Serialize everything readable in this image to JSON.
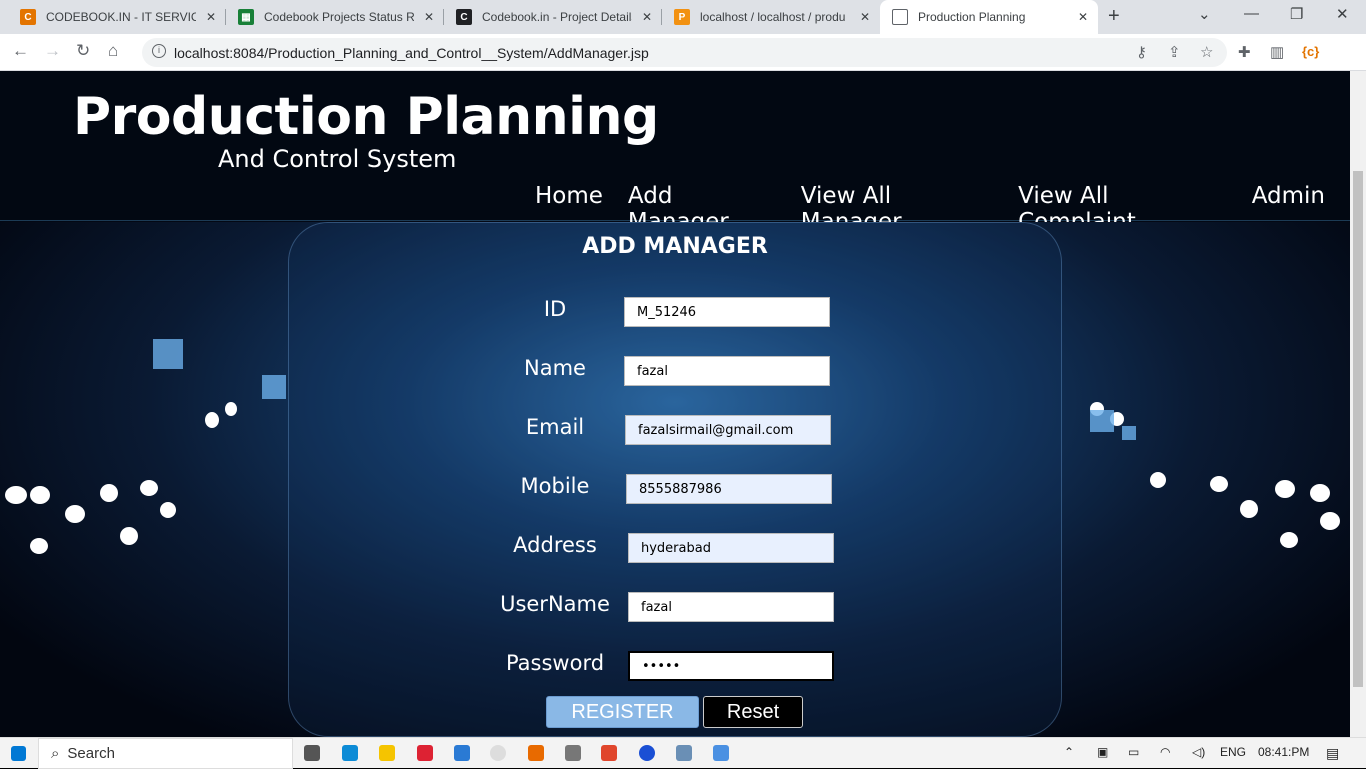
{
  "browser": {
    "tabs": [
      {
        "title": "CODEBOOK.IN - IT SERVICES",
        "icon": "codebook-icon"
      },
      {
        "title": "Codebook Projects Status Re",
        "icon": "sheets-icon"
      },
      {
        "title": "Codebook.in - Project Details",
        "icon": "codebook-dark-icon"
      },
      {
        "title": "localhost / localhost / produ",
        "icon": "phpmyadmin-icon"
      },
      {
        "title": "Production Planning",
        "icon": "page-icon"
      }
    ],
    "url": "localhost:8084/Production_Planning_and_Control__System/AddManager.jsp"
  },
  "header": {
    "title": "Production Planning",
    "subtitle": "And Control System",
    "nav": [
      "Home",
      "Add Manager",
      "View All Manager",
      "View All Complaint",
      "Admin"
    ]
  },
  "form": {
    "title": "ADD MANAGER",
    "fields": [
      {
        "label": "ID",
        "value": "M_51246"
      },
      {
        "label": "Name",
        "value": "fazal"
      },
      {
        "label": "Email",
        "value": "fazalsirmail@gmail.com"
      },
      {
        "label": "Mobile",
        "value": "8555887986"
      },
      {
        "label": "Address",
        "value": "hyderabad"
      },
      {
        "label": "UserName",
        "value": "fazal"
      },
      {
        "label": "Password",
        "value": "•••••"
      }
    ],
    "register_label": "REGISTER",
    "reset_label": "Reset"
  },
  "taskbar": {
    "search_label": "Search",
    "lang": "ENG",
    "time": "08:41:PM"
  },
  "colors": {
    "accent": "#8ab8e6",
    "page_bg": "#030814"
  }
}
